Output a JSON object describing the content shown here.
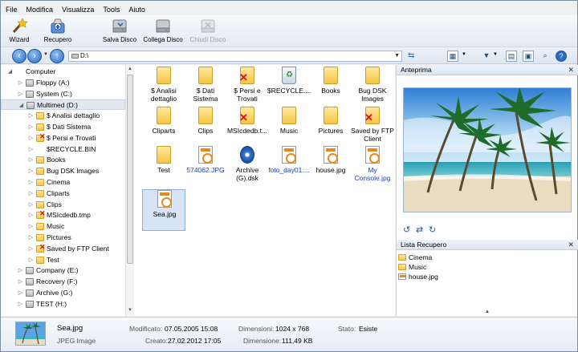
{
  "menu": [
    "File",
    "Modifica",
    "Visualizza",
    "Tools",
    "Aiuto"
  ],
  "toolbar": {
    "wizard": "Wizard",
    "recupero": "Recupero",
    "salva_disco": "Salva Disco",
    "collega_disco": "Collega Disco",
    "chiudi_disco": "Chiudi Disco"
  },
  "address": {
    "path": "D:\\"
  },
  "tree": [
    {
      "label": "Computer",
      "indent": 0,
      "icon": "computer"
    },
    {
      "label": "Floppy (A:)",
      "indent": 1,
      "icon": "drive"
    },
    {
      "label": "System (C:)",
      "indent": 1,
      "icon": "drive"
    },
    {
      "label": "Multimed (D:)",
      "indent": 1,
      "icon": "drive",
      "selected": true
    },
    {
      "label": "$ Analisi dettaglio",
      "indent": 2,
      "icon": "folder"
    },
    {
      "label": "$ Dati Sistema",
      "indent": 2,
      "icon": "folder"
    },
    {
      "label": "$ Persi e Trovati",
      "indent": 2,
      "icon": "folder-deleted"
    },
    {
      "label": "$RECYCLE.BIN",
      "indent": 2,
      "icon": "recycle"
    },
    {
      "label": "Books",
      "indent": 2,
      "icon": "folder"
    },
    {
      "label": "Bug DSK Images",
      "indent": 2,
      "icon": "folder"
    },
    {
      "label": "Cinema",
      "indent": 2,
      "icon": "folder"
    },
    {
      "label": "Cliparts",
      "indent": 2,
      "icon": "folder"
    },
    {
      "label": "Clips",
      "indent": 2,
      "icon": "folder"
    },
    {
      "label": "MSIcdedb.tmp",
      "indent": 2,
      "icon": "folder-deleted"
    },
    {
      "label": "Music",
      "indent": 2,
      "icon": "folder"
    },
    {
      "label": "Pictures",
      "indent": 2,
      "icon": "folder"
    },
    {
      "label": "Saved by FTP Client",
      "indent": 2,
      "icon": "folder-deleted"
    },
    {
      "label": "Test",
      "indent": 2,
      "icon": "folder"
    },
    {
      "label": "Company (E:)",
      "indent": 1,
      "icon": "drive"
    },
    {
      "label": "Recovery (F:)",
      "indent": 1,
      "icon": "drive"
    },
    {
      "label": "Archive (G:)",
      "indent": 1,
      "icon": "drive"
    },
    {
      "label": "TEST (H:)",
      "indent": 1,
      "icon": "drive"
    }
  ],
  "files": [
    {
      "label": "$ Analisi\ndettaglio",
      "icon": "folder"
    },
    {
      "label": "$ Dati\nSistema",
      "icon": "folder"
    },
    {
      "label": "$ Persi e\nTrovati",
      "icon": "folder-deleted"
    },
    {
      "label": "$RECYCLE....",
      "icon": "recycle"
    },
    {
      "label": "Books",
      "icon": "folder"
    },
    {
      "label": "Bug DSK\nImages",
      "icon": "folder"
    },
    {
      "label": "Cliparts",
      "icon": "folder"
    },
    {
      "label": "Clips",
      "icon": "folder"
    },
    {
      "label": "MSIcdedb.t...",
      "icon": "folder-deleted"
    },
    {
      "label": "Music",
      "icon": "folder"
    },
    {
      "label": "Pictures",
      "icon": "folder"
    },
    {
      "label": "Saved by FTP\nClient",
      "icon": "folder-deleted"
    },
    {
      "label": "Test",
      "icon": "folder"
    },
    {
      "label": "574062.JPG",
      "icon": "jpg",
      "blue": true
    },
    {
      "label": "Archive\n(G).dsk",
      "icon": "dsk"
    },
    {
      "label": "foto_day01....",
      "icon": "jpg",
      "blue": true
    },
    {
      "label": "house.jpg",
      "icon": "jpg"
    },
    {
      "label": "My\nConsole.jpg",
      "icon": "jpg",
      "blue": true
    },
    {
      "label": "Sea.jpg",
      "icon": "jpg",
      "selected": true
    }
  ],
  "preview": {
    "title": "Anteprima"
  },
  "recovery": {
    "title": "Lista Recupero",
    "items": [
      {
        "label": "Cinema",
        "icon": "folder"
      },
      {
        "label": "Music",
        "icon": "folder"
      },
      {
        "label": "house.jpg",
        "icon": "jpg"
      }
    ]
  },
  "status": {
    "name": "Sea.jpg",
    "type": "JPEG Image",
    "modified_label": "Modificato:",
    "modified_value": "07.05.2005 15:08",
    "created_label": "Creato:",
    "created_value": "27.02.2012 17:05",
    "dimensions_label": "Dimensioni:",
    "dimensions_value": "1024 x 768",
    "size_label": "Dimensione:",
    "size_value": "111,49 KB",
    "state_label": "Stato:",
    "state_value": "Esiste"
  }
}
